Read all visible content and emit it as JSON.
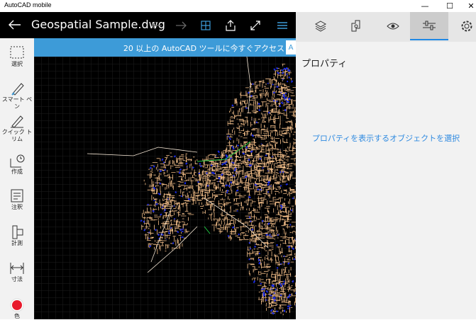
{
  "window": {
    "title": "AutoCAD mobile",
    "minimize_glyph": "—",
    "maximize_glyph": "☐",
    "close_glyph": "✕"
  },
  "toolbar": {
    "file_name": "Geospatial Sample.dwg",
    "icons": [
      "back-icon",
      "undo-icon",
      "redo-icon",
      "grid-icon",
      "share-icon",
      "fullscreen-icon",
      "menu-icon"
    ]
  },
  "tools": [
    {
      "label": "選択",
      "icon": "select-icon"
    },
    {
      "label": "スマート ペン",
      "icon": "smart-pen-icon"
    },
    {
      "label": "クイック トリム",
      "icon": "quick-trim-icon"
    },
    {
      "label": "作成",
      "icon": "create-icon"
    },
    {
      "label": "注釈",
      "icon": "annotate-icon"
    },
    {
      "label": "計測",
      "icon": "measure-icon"
    },
    {
      "label": "寸法",
      "icon": "dimension-icon"
    },
    {
      "label": "色",
      "icon": "color-icon",
      "color": "#e8192c"
    }
  ],
  "banner": {
    "text": "20 以上の AutoCAD ツールに今すぐアクセス",
    "arrow": "A"
  },
  "panel": {
    "tabs": [
      "layers-icon",
      "blocks-icon",
      "view-icon",
      "properties-icon",
      "settings-icon"
    ],
    "active_tab": 3,
    "heading": "プロパティ",
    "empty_message": "プロパティを表示するオブジェクトを選択"
  },
  "colors": {
    "accent": "#3d9bd8",
    "link": "#2f8ae0",
    "map_roads": "#f5c08a",
    "map_water": "#1a2be6",
    "canvas_bg": "#000000"
  }
}
